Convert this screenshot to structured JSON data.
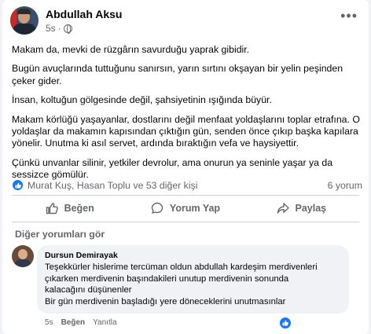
{
  "post": {
    "author": "Abdullah Aksu",
    "time": "5s",
    "separator": "·",
    "paragraphs": [
      "Makam da, mevki de rüzgârın savurduğu yaprak gibidir.",
      "Bugün avuçlarında tuttuğunu sanırsın, yarın sırtını okşayan bir yelin peşinden çeker gider.",
      "İnsan, koltuğun gölgesinde değil, şahsiyetinin ışığında büyür.",
      "Makam körlüğü yaşayanlar, dostlarını değil menfaat yoldaşlarını toplar etrafına. O yoldaşlar da makamın kapısından çıktığın gün, senden önce çıkıp başka kapılara yönelir. Unutma ki asıl servet, ardında bıraktığın vefa ve haysiyettir.",
      "Çünkü unvanlar silinir, yetkiler devrolur, ama onurun ya seninle yaşar ya da sessizce gömülür."
    ]
  },
  "reactions": {
    "names": "Murat Kuş, Hasan Toplu ve 53 diğer kişi",
    "comments": "6 yorum"
  },
  "actions": {
    "like": "Beğen",
    "comment": "Yorum Yap",
    "share": "Paylaş"
  },
  "other_comments_label": "Diğer yorumları gör",
  "comment": {
    "author": "Dursun Demirayak",
    "lines": [
      "Teşekkürler hislerime tercüman oldun abdullah kardeşim merdivenleri",
      "çıkarken merdivenin başındakileri unutup merdivenin sonunda",
      "kalacağını düşünenler",
      "Bir gün merdivenin başladığı yere döneceklerini unutmasınlar"
    ],
    "time": "5s",
    "like": "Beğen",
    "reply": "Yanıtla"
  },
  "colors": {
    "accent": "#1877f2",
    "secondary_text": "#65676b",
    "bubble": "#f0f2f5"
  },
  "icons": [
    "globe-icon",
    "more-icon",
    "like-icon",
    "comment-icon",
    "share-icon"
  ]
}
